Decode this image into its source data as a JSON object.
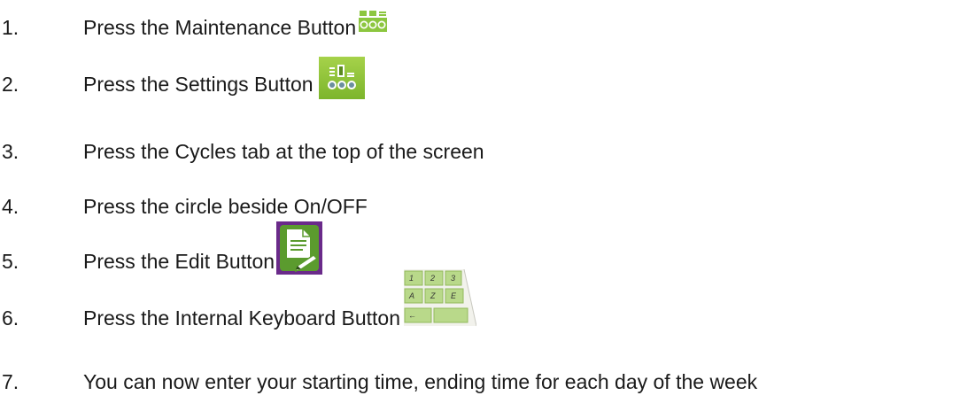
{
  "steps": [
    {
      "number": "1.",
      "text": "Press the Maintenance Button",
      "icon": "maintenance-icon"
    },
    {
      "number": "2.",
      "text": "Press the Settings Button",
      "icon": "settings-icon"
    },
    {
      "number": "3.",
      "text": "Press the Cycles tab at the top of the screen"
    },
    {
      "number": "4.",
      "text": "Press the circle beside On/OFF"
    },
    {
      "number": "5.",
      "text": "Press the Edit Button",
      "icon": "edit-icon"
    },
    {
      "number": "6.",
      "text": "Press the Internal Keyboard Button",
      "icon": "internal-keyboard-icon"
    },
    {
      "number": "7.",
      "text": "You can now enter your starting time, ending time for each day of the week"
    }
  ],
  "keyboard_keys": [
    "1",
    "2",
    "3",
    "A",
    "Z",
    "E",
    "←"
  ],
  "colors": {
    "green": "#8cc63f",
    "purple": "#6a2a8a",
    "text": "#1a1a1a"
  }
}
